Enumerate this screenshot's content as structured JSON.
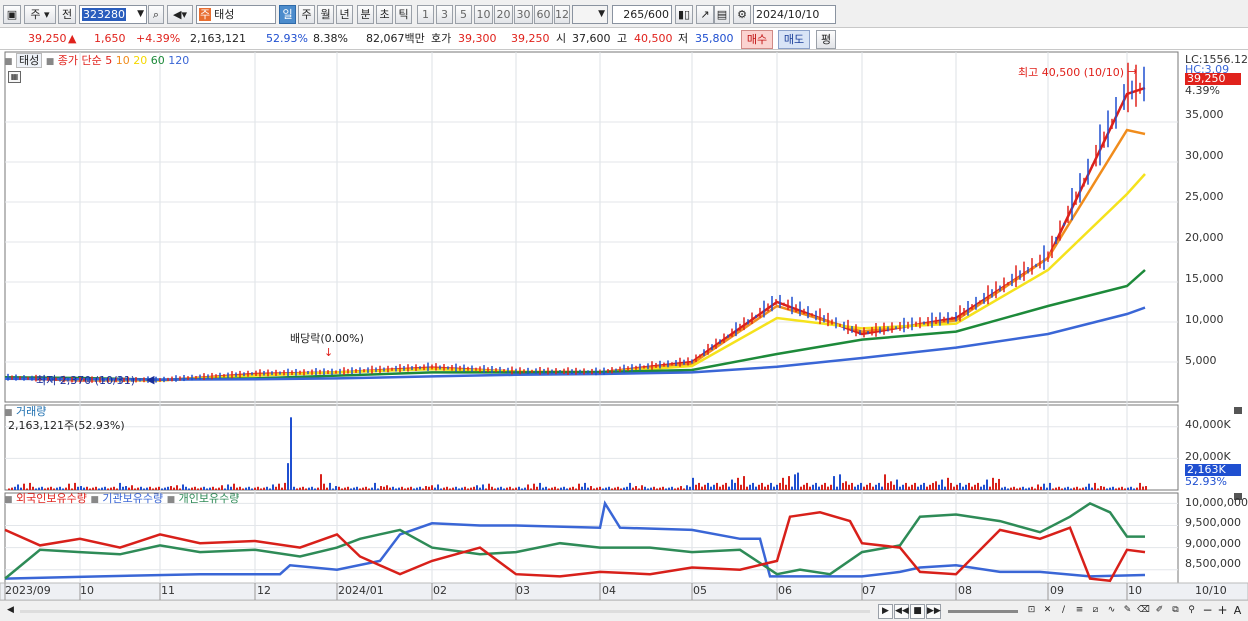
{
  "toolbar": {
    "market": "주",
    "prev": "전",
    "code": "323280",
    "name_tag": "주",
    "name": "태성",
    "periods": [
      "일",
      "주",
      "월",
      "년",
      "분",
      "초",
      "틱"
    ],
    "nums": [
      "1",
      "3",
      "5",
      "10",
      "20",
      "30",
      "60",
      "120"
    ],
    "count": "265",
    "count_max": "/600",
    "date": "2024/10/10"
  },
  "quote": {
    "price": "39,250",
    "arrow": "▲",
    "change": "1,650",
    "rate": "+4.39%",
    "volume": "2,163,121",
    "vol_ratio": "52.93%",
    "turnover": "8.38%",
    "amount": "82,067백만",
    "ask_label": "호가",
    "ask": "39,300",
    "bid": "39,250",
    "open_label": "시",
    "open": "37,600",
    "high_label": "고",
    "high": "40,500",
    "low_label": "저",
    "low": "35,800",
    "buy": "매수",
    "sell": "매도",
    "eval": "평"
  },
  "price_legend": {
    "tab": "태성",
    "ma_label": "종가 단순",
    "ma": [
      "5",
      "10",
      "20",
      "60",
      "120"
    ]
  },
  "annot": {
    "dividend": "배당락(0.00%)",
    "high": "최고 40,500 (10/10)",
    "low": "최저 2,370 (10/31)"
  },
  "right": {
    "lc": "LC:1556.12",
    "hc": "HC:3.09",
    "price_tag": "39,250",
    "rate_tag": "4.39%",
    "vol_tag": "2,163K",
    "vol_rate_tag": "52.93%"
  },
  "volume_panel": {
    "title": "거래량",
    "sub": "2,163,121주(52.93%)"
  },
  "holdings_panel": {
    "items": [
      "외국인보유수량",
      "기관보유수량",
      "개인보유수량"
    ]
  },
  "chart_data": [
    {
      "type": "line",
      "title": "",
      "subtitle": "태성 (323280) 일봉",
      "ylim": [
        0,
        42000
      ],
      "y_ticks": [
        "5,000",
        "10,000",
        "15,000",
        "20,000",
        "25,000",
        "30,000",
        "35,000"
      ],
      "x_labels": [
        "2023/09",
        "10",
        "11",
        "12",
        "2024/01",
        "02",
        "03",
        "04",
        "05",
        "06",
        "07",
        "08",
        "09",
        "10",
        "10/10"
      ],
      "x": [
        "2023/09",
        "2023/10",
        "2023/11",
        "2023/12",
        "2024/01",
        "2024/02",
        "2024/03",
        "2024/04",
        "2024/05",
        "2024/06",
        "2024/07",
        "2024/08",
        "2024/09",
        "2024/10",
        "2024/10/10"
      ],
      "series": [
        {
          "name": "5",
          "values": [
            3000,
            2700,
            2700,
            3500,
            3700,
            4300,
            3800,
            3700,
            5000,
            12500,
            8500,
            10500,
            18000,
            38500,
            39250
          ]
        },
        {
          "name": "10",
          "values": [
            3000,
            2750,
            2700,
            3400,
            3700,
            4200,
            3800,
            3700,
            4800,
            12000,
            8800,
            10200,
            18000,
            34000,
            33500
          ]
        },
        {
          "name": "20",
          "values": [
            3050,
            2800,
            2700,
            3300,
            3700,
            4100,
            3800,
            3700,
            4500,
            10500,
            9200,
            9800,
            16500,
            26000,
            28500
          ]
        },
        {
          "name": "60",
          "values": [
            3100,
            3000,
            2800,
            2950,
            3300,
            3700,
            3700,
            3750,
            4000,
            6000,
            7800,
            8800,
            12000,
            14500,
            16500
          ]
        },
        {
          "name": "120",
          "values": [
            2900,
            2850,
            2800,
            2850,
            2950,
            3200,
            3400,
            3500,
            3700,
            4400,
            5500,
            6800,
            8500,
            11000,
            11800
          ]
        }
      ]
    },
    {
      "type": "bar",
      "title": "거래량",
      "ylim": [
        0,
        50000
      ],
      "y_ticks": [
        "20,000K",
        "40,000K"
      ],
      "unit": "K",
      "last_value": 2163
    },
    {
      "type": "line",
      "title": "",
      "ylim": [
        8200000,
        10100000
      ],
      "y_ticks": [
        "8,500,000",
        "9,000,000",
        "9,500,000",
        "10,000,000"
      ],
      "series": [
        {
          "name": "외국인보유수량"
        },
        {
          "name": "기관보유수량"
        },
        {
          "name": "개인보유수량"
        }
      ]
    }
  ]
}
